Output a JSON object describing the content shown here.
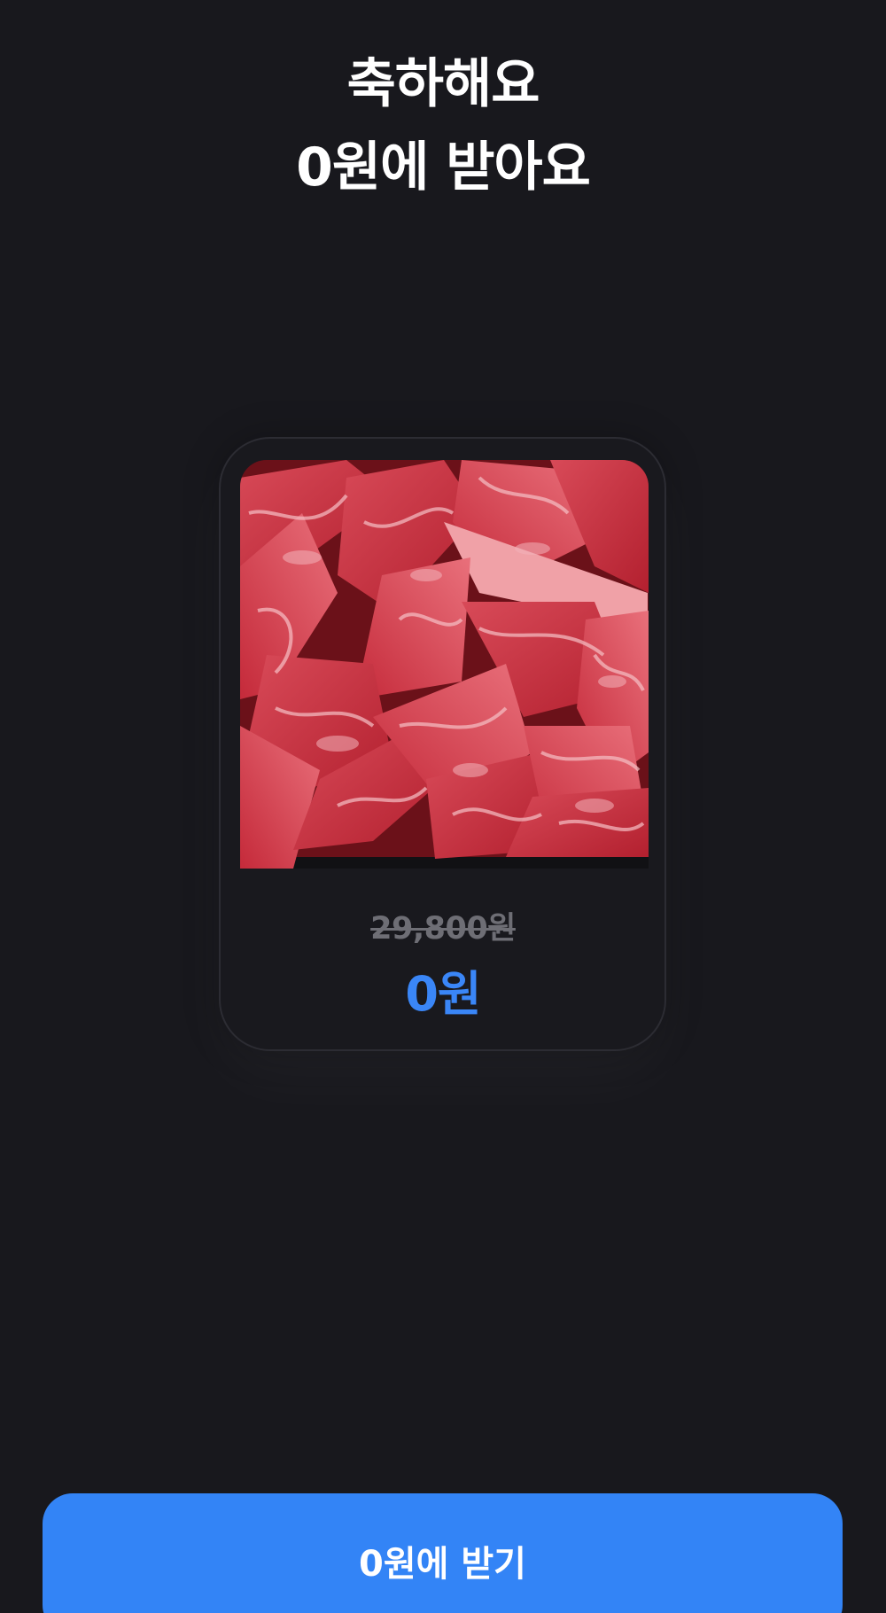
{
  "headline": {
    "line1": "축하해요",
    "line2": "0원에 받아요"
  },
  "product": {
    "image_icon": "beef-photo-icon",
    "original_price": "29,800원",
    "sale_price": "0원"
  },
  "cta": {
    "label": "0원에 받기"
  },
  "colors": {
    "background": "#18181d",
    "accent": "#3384f6",
    "price_accent": "#3a86f7",
    "muted_text": "#6e6e75"
  }
}
